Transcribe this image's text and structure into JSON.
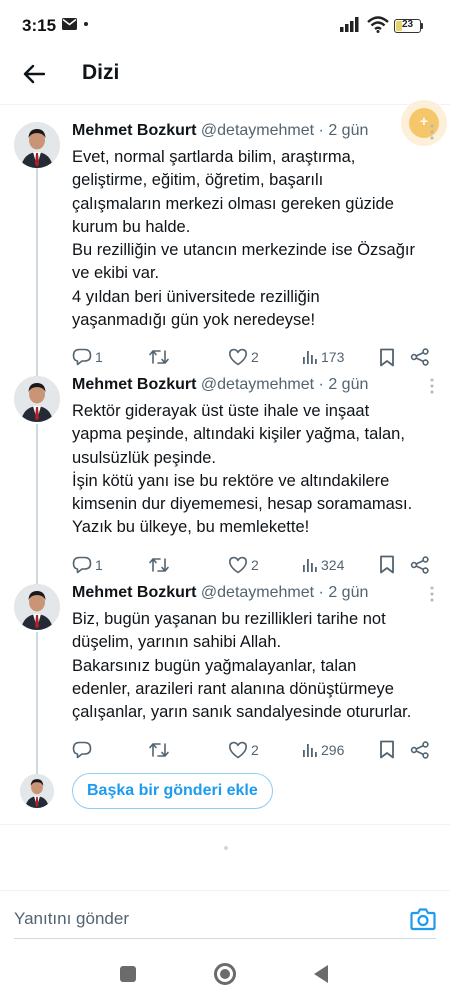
{
  "status": {
    "time": "3:15",
    "battery": "23",
    "battery_level": 0.23,
    "icons": [
      "mail-icon",
      "signal-icon",
      "wifi-icon",
      "battery-icon"
    ]
  },
  "header": {
    "title": "Dizi",
    "back_icon": "arrow-left-icon"
  },
  "colors": {
    "accent": "#1d9bf0",
    "muted": "#536471",
    "thread_line": "#cfd9de"
  },
  "posts": [
    {
      "author": "Mehmet Bozkurt",
      "handle": "@detaymehmet",
      "time": "· 2 gün",
      "text": "Evet, normal şartlarda bilim, araştırma,\ngeliştirme, eğitim, öğretim, başarılı\nçalışmaların merkezi olması gereken güzide\nkurum bu halde.\nBu rezilliğin ve utancın merkezinde ise Özsağır\nve ekibi var.\n4 yıldan beri üniversitede rezilliğin\nyaşanmadığı gün yok neredeyse!",
      "replies": "1",
      "reposts": "",
      "likes": "2",
      "views": "173"
    },
    {
      "author": "Mehmet Bozkurt",
      "handle": "@detaymehmet",
      "time": "· 2 gün",
      "text": "Rektör giderayak üst üste ihale ve inşaat\nyapma peşinde, altındaki kişiler yağma, talan,\nusulsüzlük peşinde.\nİşin kötü yanı ise bu rektöre ve altındakilere\nkimsenin dur diyememesi, hesap soramaması.\nYazık bu ülkeye, bu memlekette!",
      "replies": "1",
      "reposts": "",
      "likes": "2",
      "views": "324"
    },
    {
      "author": "Mehmet Bozkurt",
      "handle": "@detaymehmet",
      "time": "· 2 gün",
      "text": "Biz, bugün yaşanan bu rezillikleri tarihe not\ndüşelim, yarının sahibi Allah.\nBakarsınız bugün yağmalayanlar, talan\nedenler, arazileri rant alanına dönüştürmeye\nçalışanlar, yarın sanık sandalyesinde otururlar.",
      "replies": "",
      "reposts": "",
      "likes": "2",
      "views": "296"
    }
  ],
  "add_post": {
    "label": "Başka bir gönderi ekle"
  },
  "reply": {
    "placeholder": "Yanıtını gönder"
  }
}
